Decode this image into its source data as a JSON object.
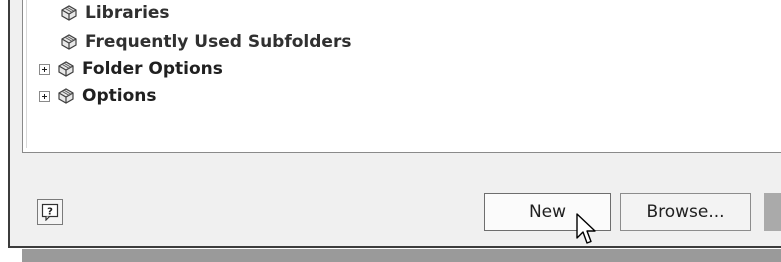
{
  "tree": {
    "items": [
      {
        "label": "Libraries",
        "expandable": false,
        "icon": "folder-stack-icon"
      },
      {
        "label": "Frequently Used Subfolders",
        "expandable": false,
        "icon": "folder-stack-icon"
      },
      {
        "label": "Folder Options",
        "expandable": true,
        "icon": "folder-stack-icon"
      },
      {
        "label": "Options",
        "expandable": true,
        "icon": "folder-stack-icon"
      }
    ]
  },
  "footer": {
    "help_icon": "question-mark-icon",
    "new_label": "New",
    "browse_label": "Browse..."
  },
  "cursor": {
    "icon": "arrow-pointer-icon"
  },
  "colors": {
    "dialog_bg": "#f0f0f0",
    "panel_bg": "#ffffff",
    "shadow": "#9a9a9a"
  }
}
